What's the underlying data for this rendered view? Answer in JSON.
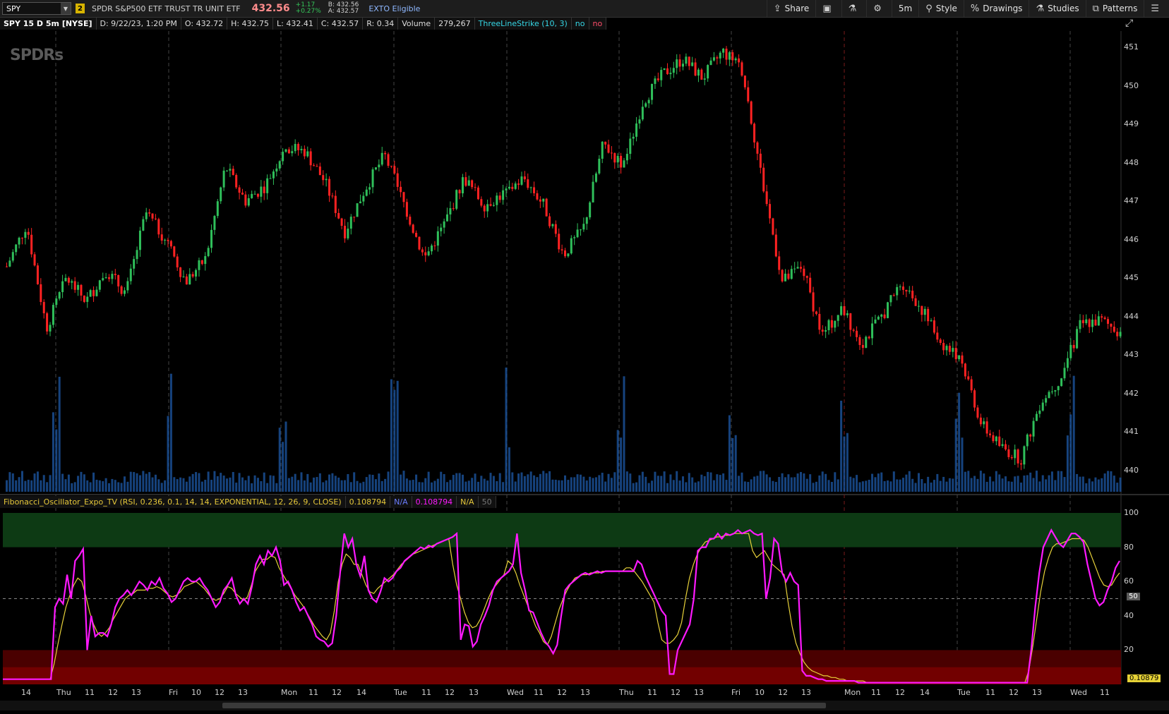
{
  "toolbar": {
    "symbol": "SPY",
    "link_number": "2",
    "description": "SPDR S&P500 ETF TRUST TR UNIT ETF",
    "last_price": "432.56",
    "net_change": "+1.17",
    "pct_change": "+0.27%",
    "bid": "B: 432.56",
    "ask": "A: 432.57",
    "exto": "EXTO Eligible",
    "buttons": {
      "share": "Share",
      "timeframe": "5m",
      "style": "Style",
      "drawings": "Drawings",
      "studies": "Studies",
      "patterns": "Patterns"
    }
  },
  "infobar": {
    "title": "SPY 15 D 5m [NYSE]",
    "date": "D: 9/22/23, 1:20 PM",
    "open": "O: 432.72",
    "high": "H: 432.75",
    "low": "L: 432.41",
    "close": "C: 432.57",
    "range": "R: 0.34",
    "volume_label": "Volume",
    "volume_value": "279,267",
    "study": "ThreeLineStrike (10, 3)",
    "study_v1": "no",
    "study_v2": "no"
  },
  "lower_study": {
    "title": "Fibonacci_Oscillator_Expo_TV (RSI, 0.236, 0.1, 14, 14, EXPONENTIAL, 12, 26, 9, CLOSE)",
    "v1": "0.108794",
    "v2": "N/A",
    "v3": "0.108794",
    "v4": "N/A",
    "v5": "50",
    "badge_mid": "50",
    "badge_last": "0.10879"
  },
  "logo_text": "SPDRs",
  "colors": {
    "up": "#2fbf5a",
    "down": "#ff2222",
    "volume": "#1e5aa8",
    "magenta": "#ff19ff",
    "yellow": "#e8d23a",
    "green_zone": "#0d3a14",
    "red_zone": "#4a0000",
    "red_zone_deep": "#720000"
  },
  "chart_data": [
    {
      "type": "candlestick",
      "title": "SPY 15 D 5m [NYSE]",
      "y_ticks": [
        "451",
        "450",
        "449",
        "448",
        "447",
        "446",
        "445",
        "444",
        "443",
        "442",
        "441",
        "440"
      ],
      "ylim": [
        439.8,
        451.4
      ],
      "x_ticks": [
        "14",
        "Thu",
        "11",
        "12",
        "13",
        "Fri",
        "10",
        "12",
        "13",
        "Mon",
        "11",
        "12",
        "14",
        "Tue",
        "11",
        "12",
        "13",
        "Wed",
        "11",
        "12",
        "13",
        "Thu",
        "11",
        "12",
        "13",
        "Fri",
        "10",
        "12",
        "13",
        "Mon",
        "11",
        "12",
        "14",
        "Tue",
        "11",
        "12",
        "13",
        "Wed",
        "11"
      ],
      "session_close_path": [
        445.3,
        446.4,
        443.7,
        445.0,
        444.4,
        445.2,
        444.6,
        446.7,
        446.0,
        444.9,
        445.5,
        447.9,
        447.0,
        447.4,
        448.4,
        448.3,
        447.5,
        446.2,
        447.3,
        448.2,
        446.9,
        445.5,
        446.4,
        447.6,
        446.9,
        447.2,
        447.6,
        446.9,
        445.6,
        446.3,
        448.5,
        447.9,
        449.6,
        450.3,
        450.7,
        450.2,
        450.9,
        450.4,
        447.5,
        444.9,
        445.3,
        443.5,
        444.2,
        443.3,
        444.0,
        444.9,
        444.2,
        443.3,
        442.9,
        441.2,
        440.6,
        440.3,
        441.8,
        442.4,
        443.8,
        443.9,
        443.6
      ]
    },
    {
      "type": "line",
      "title": "Fibonacci_Oscillator_Expo_TV (RSI, 0.236, 0.1, 14, 14, EXPONENTIAL, 12, 26, 9, CLOSE)",
      "y_ticks": [
        "100",
        "80",
        "60",
        "40",
        "20"
      ],
      "ylim": [
        0,
        100
      ],
      "series": [
        {
          "name": "",
          "values": [
            3,
            3,
            3,
            3,
            3,
            3,
            3,
            3,
            3,
            3,
            3,
            3,
            3,
            45,
            50,
            47,
            64,
            50,
            72,
            75,
            79,
            20,
            40,
            28,
            30,
            30,
            28,
            35,
            45,
            50,
            52,
            55,
            52,
            56,
            60,
            58,
            55,
            60,
            58,
            62,
            56,
            53,
            48,
            50,
            55,
            60,
            62,
            60,
            60,
            62,
            58,
            55,
            50,
            45,
            48,
            55,
            58,
            62,
            52,
            47,
            50,
            47,
            57,
            70,
            75,
            70,
            78,
            75,
            80,
            72,
            58,
            60,
            55,
            48,
            43,
            45,
            40,
            35,
            28,
            26,
            25,
            22,
            24,
            40,
            66,
            88,
            80,
            85,
            70,
            63,
            75,
            55,
            50,
            48,
            54,
            62,
            60,
            62,
            66,
            68,
            72,
            74,
            76,
            78,
            80,
            79,
            81,
            80,
            82,
            83,
            84,
            85,
            86,
            88,
            26,
            35,
            34,
            22,
            25,
            35,
            40,
            46,
            55,
            60,
            62,
            64,
            66,
            70,
            88,
            65,
            55,
            43,
            42,
            36,
            30,
            25,
            22,
            18,
            23,
            40,
            55,
            58,
            60,
            62,
            64,
            65,
            64,
            65,
            66,
            65,
            66,
            66,
            66,
            66,
            66,
            66,
            66,
            66,
            72,
            70,
            63,
            58,
            53,
            48,
            43,
            40,
            6,
            6,
            20,
            25,
            30,
            35,
            50,
            78,
            80,
            80,
            85,
            85,
            88,
            85,
            88,
            87,
            88,
            90,
            88,
            89,
            90,
            88,
            87,
            88,
            50,
            62,
            85,
            82,
            65,
            60,
            65,
            60,
            58,
            8,
            5,
            5,
            4,
            3,
            3,
            2,
            2,
            2,
            2,
            2,
            2,
            2,
            2,
            1,
            1,
            1,
            1,
            1,
            1,
            1,
            1,
            1,
            1,
            1,
            1,
            1,
            1,
            1,
            1,
            1,
            1,
            1,
            1,
            1,
            1,
            1,
            1,
            1,
            1,
            1,
            1,
            1,
            1,
            1,
            1,
            1,
            1,
            1,
            1,
            1,
            1,
            1,
            1,
            1,
            1,
            1,
            20,
            45,
            65,
            80,
            85,
            90,
            86,
            82,
            80,
            84,
            88,
            88,
            86,
            83,
            70,
            60,
            50,
            46,
            48,
            55,
            60,
            68,
            72
          ]
        },
        {
          "name": "",
          "values": [
            3,
            3,
            3,
            3,
            3,
            3,
            3,
            3,
            3,
            3,
            3,
            3,
            3,
            12,
            24,
            35,
            45,
            52,
            58,
            62,
            60,
            52,
            42,
            35,
            30,
            28,
            30,
            33,
            38,
            42,
            46,
            50,
            52,
            53,
            55,
            55,
            55,
            56,
            56,
            57,
            56,
            54,
            52,
            51,
            52,
            54,
            57,
            58,
            59,
            60,
            58,
            56,
            53,
            50,
            49,
            50,
            53,
            57,
            56,
            53,
            51,
            49,
            51,
            58,
            66,
            70,
            73,
            73,
            75,
            74,
            68,
            64,
            60,
            56,
            52,
            49,
            46,
            42,
            38,
            34,
            31,
            28,
            26,
            30,
            43,
            60,
            70,
            76,
            74,
            70,
            70,
            64,
            58,
            54,
            53,
            56,
            58,
            60,
            62,
            64,
            67,
            70,
            72,
            74,
            76,
            77,
            78,
            79,
            80,
            81,
            82,
            83,
            84,
            85,
            70,
            58,
            50,
            42,
            36,
            33,
            34,
            38,
            44,
            50,
            55,
            58,
            61,
            64,
            72,
            70,
            65,
            58,
            52,
            46,
            40,
            34,
            30,
            25,
            23,
            28,
            36,
            44,
            50,
            55,
            59,
            62,
            63,
            64,
            64,
            65,
            65,
            65,
            66,
            66,
            66,
            66,
            66,
            66,
            68,
            68,
            66,
            63,
            60,
            56,
            52,
            48,
            36,
            26,
            24,
            24,
            26,
            29,
            36,
            50,
            62,
            70,
            76,
            80,
            83,
            84,
            85,
            86,
            86,
            87,
            87,
            88,
            88,
            88,
            88,
            88,
            78,
            74,
            76,
            78,
            74,
            70,
            68,
            66,
            64,
            48,
            34,
            24,
            18,
            13,
            10,
            8,
            7,
            6,
            5,
            5,
            4,
            4,
            3,
            3,
            2,
            2,
            2,
            2,
            2,
            1,
            1,
            1,
            1,
            1,
            1,
            1,
            1,
            1,
            1,
            1,
            1,
            1,
            1,
            1,
            1,
            1,
            1,
            1,
            1,
            1,
            1,
            1,
            1,
            1,
            1,
            1,
            1,
            1,
            1,
            1,
            1,
            1,
            1,
            1,
            1,
            1,
            1,
            1,
            1,
            1,
            8,
            22,
            38,
            54,
            66,
            74,
            80,
            82,
            82,
            83,
            84,
            85,
            85,
            85,
            84,
            80,
            74,
            68,
            62,
            58,
            57,
            58,
            62,
            65
          ]
        }
      ]
    }
  ]
}
